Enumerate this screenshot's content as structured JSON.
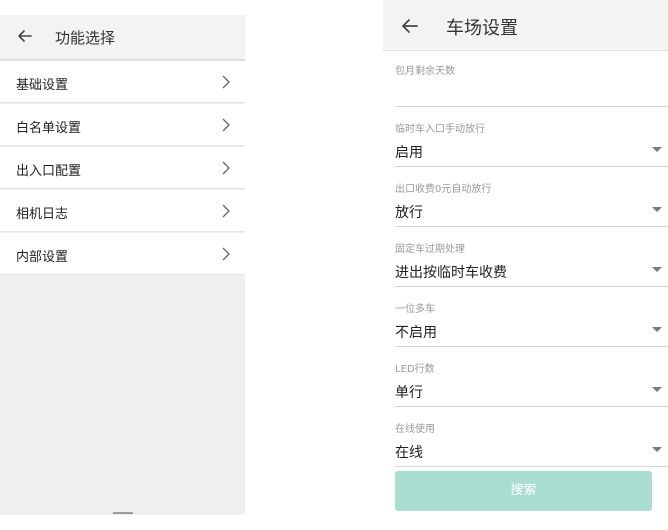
{
  "left_panel": {
    "title": "功能选择",
    "items": [
      {
        "label": "基础设置"
      },
      {
        "label": "白名单设置"
      },
      {
        "label": "出入口配置"
      },
      {
        "label": "相机日志"
      },
      {
        "label": "内部设置"
      }
    ]
  },
  "right_panel": {
    "title": "车场设置",
    "fields": [
      {
        "label": "包月剩余天数",
        "value": ""
      },
      {
        "label": "临时车入口手动放行",
        "value": "启用"
      },
      {
        "label": "出口收费0元自动放行",
        "value": "放行"
      },
      {
        "label": "固定车过期处理",
        "value": "进出按临时车收费"
      },
      {
        "label": "一位多车",
        "value": "不启用"
      },
      {
        "label": "LED行数",
        "value": "单行"
      },
      {
        "label": "在线使用",
        "value": "在线"
      }
    ],
    "search_label": "搜索"
  },
  "colors": {
    "accent_button": "#a8ddd0",
    "panel_background": "#efefef"
  },
  "icons": {
    "back": "arrow-left-icon",
    "chevron": "chevron-right-icon",
    "dropdown": "caret-down-icon"
  }
}
